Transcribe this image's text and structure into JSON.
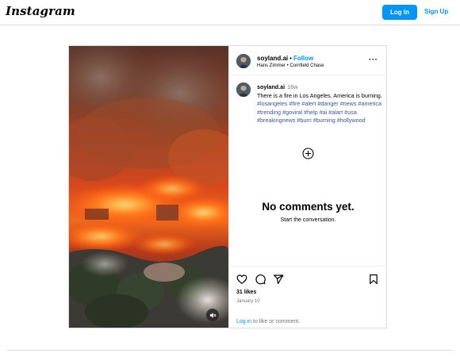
{
  "brand": {
    "logo_text": "Instagram"
  },
  "header": {
    "login_label": "Log In",
    "signup_label": "Sign Up",
    "accent": "#0095f6"
  },
  "post": {
    "author": "soyland.ai",
    "separator": "•",
    "follow_label": "Follow",
    "audio": "Hans Zimmer • Cornfield Chase",
    "more_icon": "more-horizontal-icon",
    "caption": {
      "time": "16w",
      "text": "There is a fire in Los Angeles. America is burning.",
      "hashtags": "#losangeles #fire #alert #danger #news #america #trending #goviral #help #ai #alart #usa #breakingnews #burn #burning #hollywood"
    },
    "load_more_icon": "plus-circle-icon",
    "empty_title": "No comments yet.",
    "empty_sub": "Start the conversation.",
    "icons": [
      "heart-icon",
      "comment-icon",
      "share-icon",
      "bookmark-icon"
    ],
    "likes": "31 likes",
    "date": "January 10",
    "login_link": "Log in",
    "login_rest": " to like or comment.",
    "mute_icon": "mute-icon"
  }
}
